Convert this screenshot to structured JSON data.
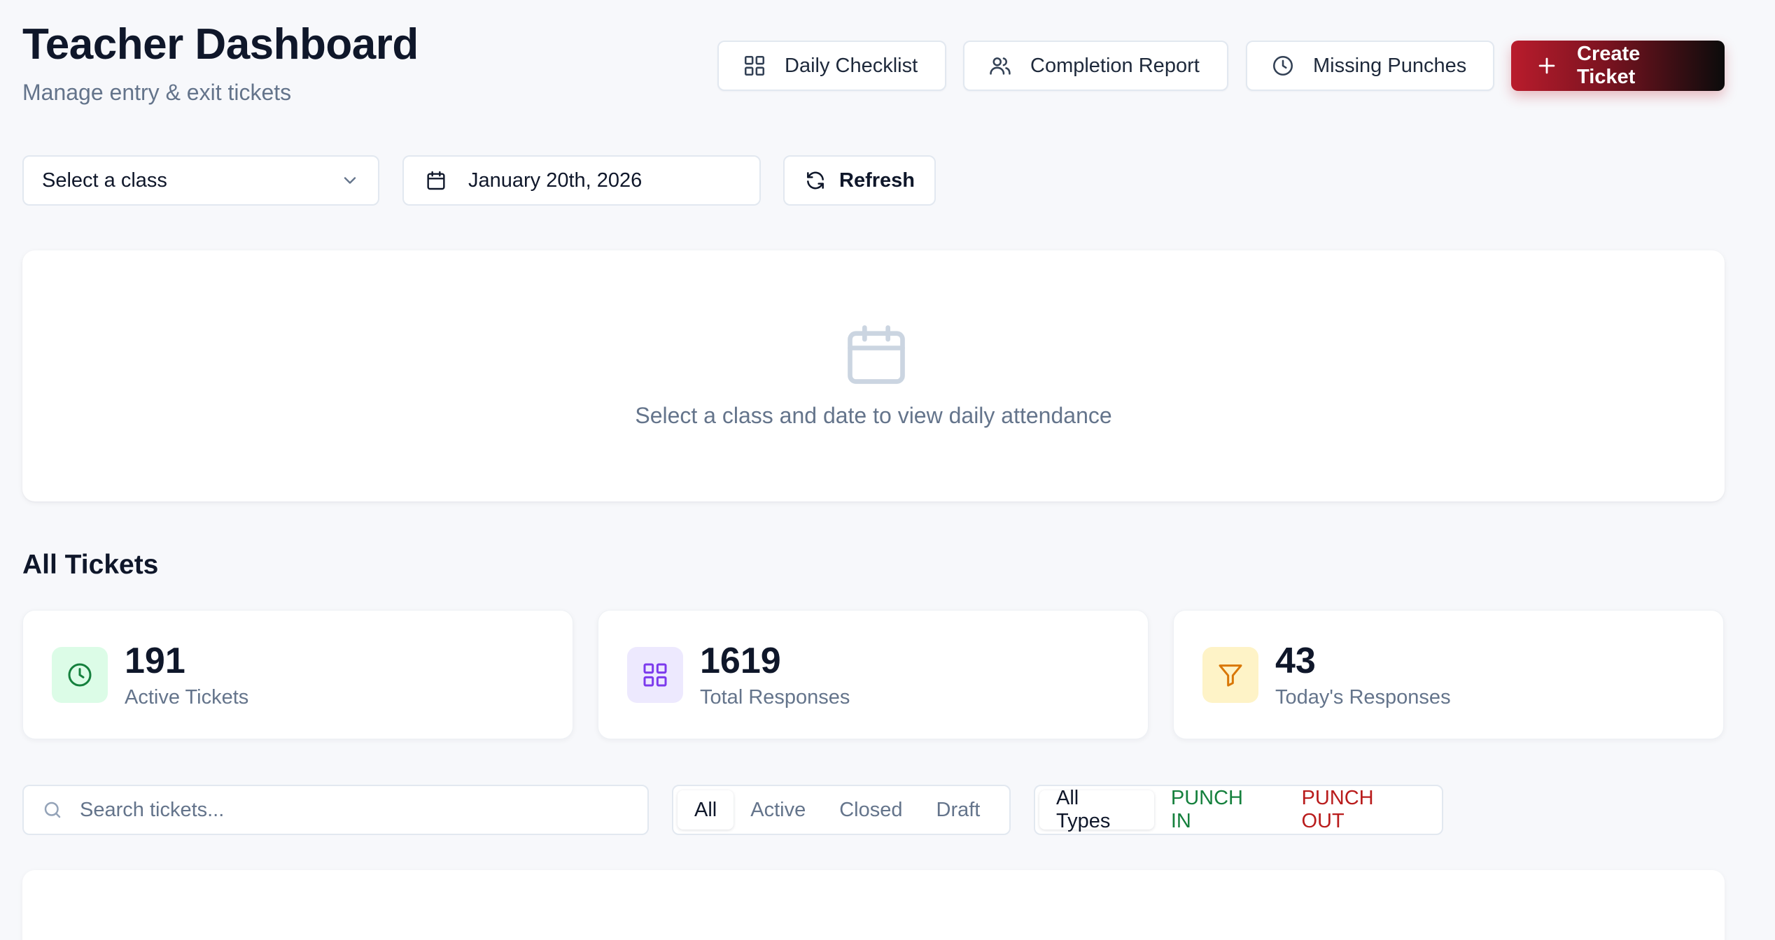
{
  "header": {
    "title": "Teacher Dashboard",
    "subtitle": "Manage entry & exit tickets",
    "buttons": {
      "daily_checklist": "Daily Checklist",
      "completion_report": "Completion Report",
      "missing_punches": "Missing Punches",
      "create_ticket": "Create Ticket"
    }
  },
  "controls": {
    "class_select": "Select a class",
    "date": "January 20th, 2026",
    "refresh": "Refresh"
  },
  "empty_state": {
    "icon": "calendar-icon",
    "message": "Select a class and date to view daily attendance"
  },
  "tickets": {
    "section_title": "All Tickets",
    "stats": [
      {
        "value": "191",
        "label": "Active Tickets",
        "icon": "clock-icon",
        "color": "#16a34a"
      },
      {
        "value": "1619",
        "label": "Total Responses",
        "icon": "grid-icon",
        "color": "#7c3aed"
      },
      {
        "value": "43",
        "label": "Today's Responses",
        "icon": "filter-icon",
        "color": "#d97706"
      }
    ],
    "search_placeholder": "Search tickets...",
    "status_filters": [
      "All",
      "Active",
      "Closed",
      "Draft"
    ],
    "status_selected": "All",
    "type_filters": [
      "All Types",
      "PUNCH IN",
      "PUNCH OUT"
    ],
    "type_selected": "All Types"
  },
  "colors": {
    "accent": "#b91c2c",
    "punch_in": "#15803d",
    "punch_out": "#b91c1c"
  }
}
